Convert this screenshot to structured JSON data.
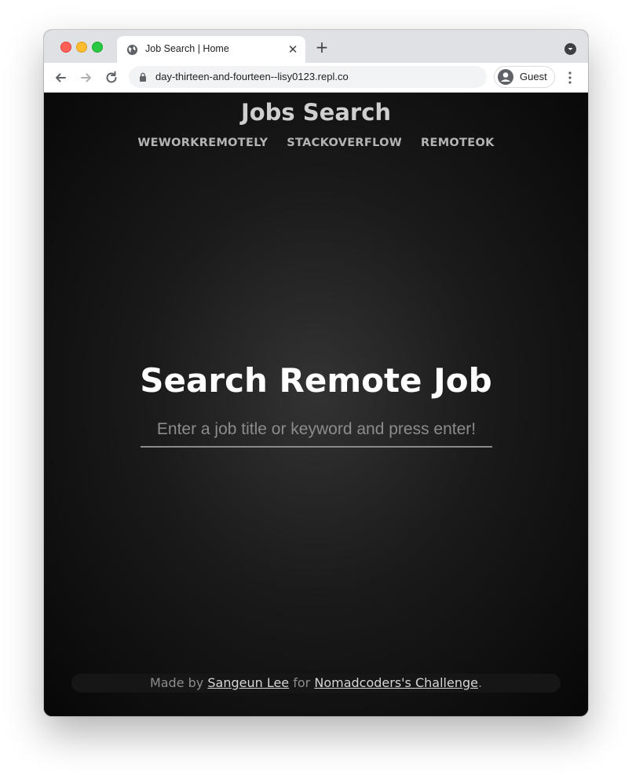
{
  "browser": {
    "tab_title": "Job Search | Home",
    "tab_close_glyph": "✕",
    "new_tab_glyph": "+",
    "url": "day-thirteen-and-fourteen--lisy0123.repl.co",
    "profile_label": "Guest"
  },
  "header": {
    "title": "Jobs Search",
    "nav": [
      "WEWORKREMOTELY",
      "STACKOVERFLOW",
      "REMOTEOK"
    ]
  },
  "main": {
    "title": "Search Remote Job",
    "search_placeholder": "Enter a job title or keyword and press enter!"
  },
  "footer": {
    "made_by": "Made by",
    "author": "Sangeun Lee",
    "for_text": "for",
    "challenge": "Nomadcoders's Challenge",
    "end": "."
  },
  "colors": {
    "traffic_red": "#fe5f57",
    "traffic_yellow": "#febc2e",
    "traffic_green": "#28c840"
  },
  "icons": [
    "globe-icon",
    "close-icon",
    "plus-icon",
    "tab-search-icon",
    "back-arrow-icon",
    "forward-arrow-icon",
    "reload-icon",
    "lock-icon",
    "avatar-icon",
    "kebab-menu-icon"
  ]
}
